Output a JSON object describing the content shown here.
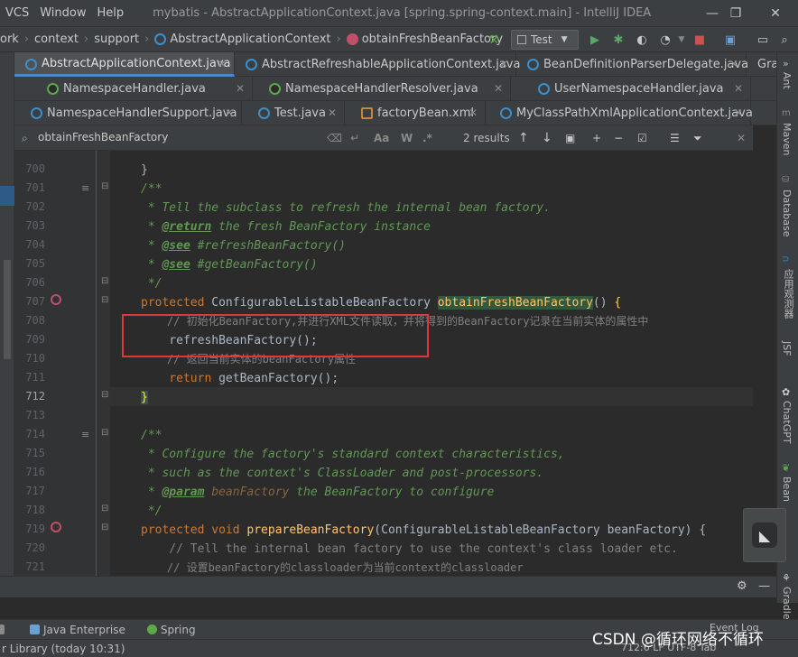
{
  "menu": {
    "items": [
      "VCS",
      "Window",
      "Help"
    ],
    "title": "mybatis - AbstractApplicationContext.java [spring.spring-context.main] - IntelliJ IDEA"
  },
  "window": {
    "minimize": "—",
    "restore": "❐",
    "close": "✕"
  },
  "breadcrumbs": [
    "ork",
    "context",
    "support",
    "AbstractApplicationContext",
    "obtainFreshBeanFactory"
  ],
  "run_config": {
    "label": "Test",
    "arrow": "▼"
  },
  "tabs_row1": [
    "AbstractApplicationContext.java",
    "AbstractRefreshableApplicationContext.java",
    "BeanDefinitionParserDelegate.java",
    "Grad"
  ],
  "tabs_row2": [
    "NamespaceHandler.java",
    "NamespaceHandlerResolver.java",
    "UserNamespaceHandler.java"
  ],
  "tabs_row3": [
    "NamespaceHandlerSupport.java",
    "Test.java",
    "factoryBean.xml",
    "MyClassPathXmlApplicationContext.java"
  ],
  "search": {
    "value": "obtainFreshBeanFactory",
    "results": "2 results",
    "match_case": "Aa",
    "words": "W",
    "regex": ".*"
  },
  "line_numbers": [
    "700",
    "701",
    "702",
    "703",
    "704",
    "705",
    "706",
    "707",
    "708",
    "709",
    "710",
    "711",
    "712",
    "713",
    "714",
    "715",
    "716",
    "717",
    "718",
    "719",
    "720",
    "721"
  ],
  "code": {
    "l700": "}",
    "l701": "/**",
    "l702": " * Tell the subclass to refresh the internal bean factory.",
    "l703_a": " * ",
    "l703_tag": "@return",
    "l703_b": " the fresh BeanFactory instance",
    "l704_a": " * ",
    "l704_tag": "@see",
    "l704_b": " #refreshBeanFactory()",
    "l705_a": " * ",
    "l705_tag": "@see",
    "l705_b": " #getBeanFactory()",
    "l706": " */",
    "l707_kw": "protected",
    "l707_type": " ConfigurableListableBeanFactory ",
    "l707_method": "obtainFreshBeanFactory",
    "l707_rest": "() ",
    "l707_brace": "{",
    "l708": "    // 初始化BeanFactory,并进行XML文件读取，并将得到的BeanFactory记录在当前实体的属性中",
    "l709": "    refreshBeanFactory();",
    "l710": "    // 返回当前实体的beanFactory属性",
    "l711_kw": "    return",
    "l711_rest": " getBeanFactory();",
    "l712": "}",
    "l714": "/**",
    "l715": " * Configure the factory's standard context characteristics,",
    "l716": " * such as the context's ClassLoader and post-processors.",
    "l717_a": " * ",
    "l717_tag": "@param",
    "l717_p": " beanFactory",
    "l717_b": " the BeanFactory to configure",
    "l718": " */",
    "l719_kw": "protected void",
    "l719_sp": " ",
    "l719_method": "prepareBeanFactory",
    "l719_rest": "(ConfigurableListableBeanFactory beanFactory) {",
    "l720": "    // Tell the internal bean factory to use the context's class loader etc.",
    "l721": "    // 设置beanFactory的classloader为当前context的classloader"
  },
  "right_tools": [
    "Ant",
    "Maven",
    "Database",
    "应用观测器",
    "JSF",
    "ChatGPT",
    "Bean",
    "Gradle"
  ],
  "tool_windows": [
    "Java Enterprise",
    "Spring"
  ],
  "status": {
    "message": "r Library (today 10:31)",
    "encoding": "712:6  LF  UTF-8  Tab",
    "event_log": "Event Log"
  },
  "watermark": "CSDN @循环网络不循环",
  "colors": {
    "accent": "#4a88c7",
    "red_box": "#e0383a",
    "keyword": "#cc7832",
    "method": "#ffc66d",
    "doc": "#629755",
    "comment": "#808080"
  }
}
